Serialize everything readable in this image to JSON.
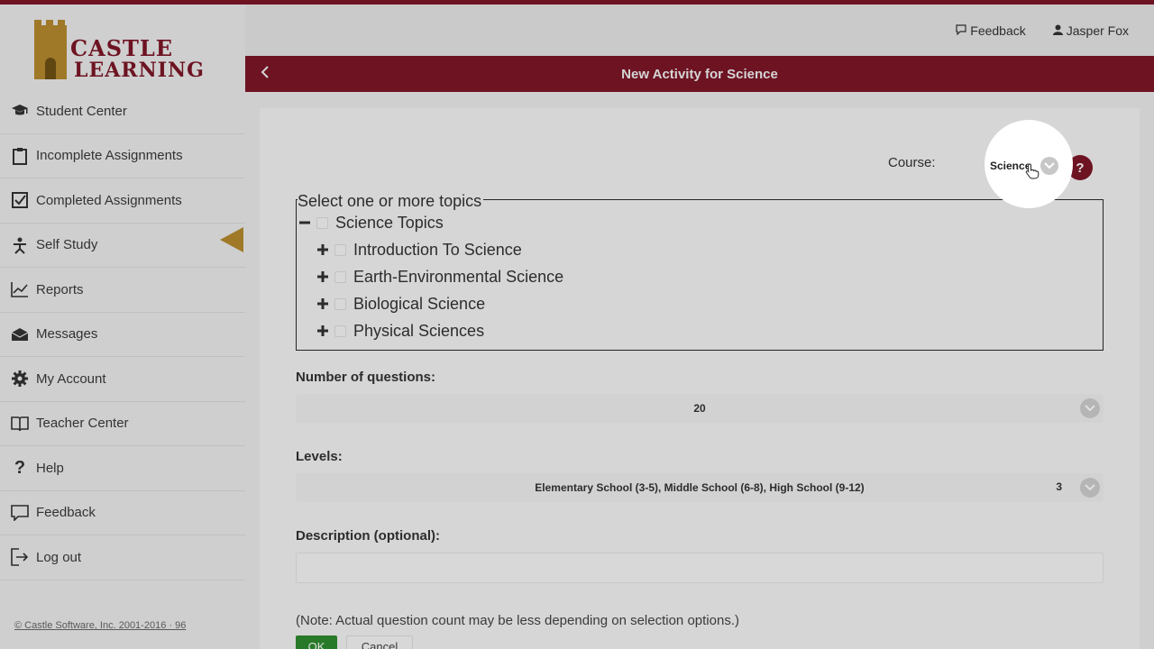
{
  "app": {
    "logo_line1": "CASTLE",
    "logo_line2": "LEARNING",
    "brand_color": "#7d1627",
    "accent_gold": "#b58a2e"
  },
  "toplinks": {
    "feedback": "Feedback",
    "user": "Jasper Fox"
  },
  "sidebar": {
    "items": [
      {
        "label": "Student Center",
        "icon": "graduation-cap-icon"
      },
      {
        "label": "Incomplete Assignments",
        "icon": "clipboard-icon"
      },
      {
        "label": "Completed Assignments",
        "icon": "checkbox-icon"
      },
      {
        "label": "Self Study",
        "icon": "self-study-icon"
      },
      {
        "label": "Reports",
        "icon": "chart-line-icon"
      },
      {
        "label": "Messages",
        "icon": "envelope-icon"
      },
      {
        "label": "My Account",
        "icon": "gear-icon"
      },
      {
        "label": "Teacher Center",
        "icon": "book-icon"
      },
      {
        "label": "Help",
        "icon": "question-icon"
      },
      {
        "label": "Feedback",
        "icon": "comment-icon"
      },
      {
        "label": "Log out",
        "icon": "logout-icon"
      }
    ],
    "copyright": "© Castle Software, Inc. 2001-2016 · 96"
  },
  "panel": {
    "title": "New Activity for Science",
    "course_label": "Course:",
    "course_value": "Science",
    "help": "?",
    "topics_legend": "Select one or more topics",
    "topic_root": "Science Topics",
    "topics": [
      "Introduction To Science",
      "Earth-Environmental Science",
      "Biological Science",
      "Physical Sciences"
    ],
    "num_questions_label": "Number of questions:",
    "num_questions_value": "20",
    "levels_label": "Levels:",
    "levels_value": "Elementary School (3-5), Middle School (6-8), High School (9-12)",
    "levels_count": "3",
    "description_label": "Description (optional):",
    "description_value": "",
    "note": "(Note: Actual question count may be less depending on selection options.)",
    "ok_label": "OK",
    "cancel_label": "Cancel"
  }
}
